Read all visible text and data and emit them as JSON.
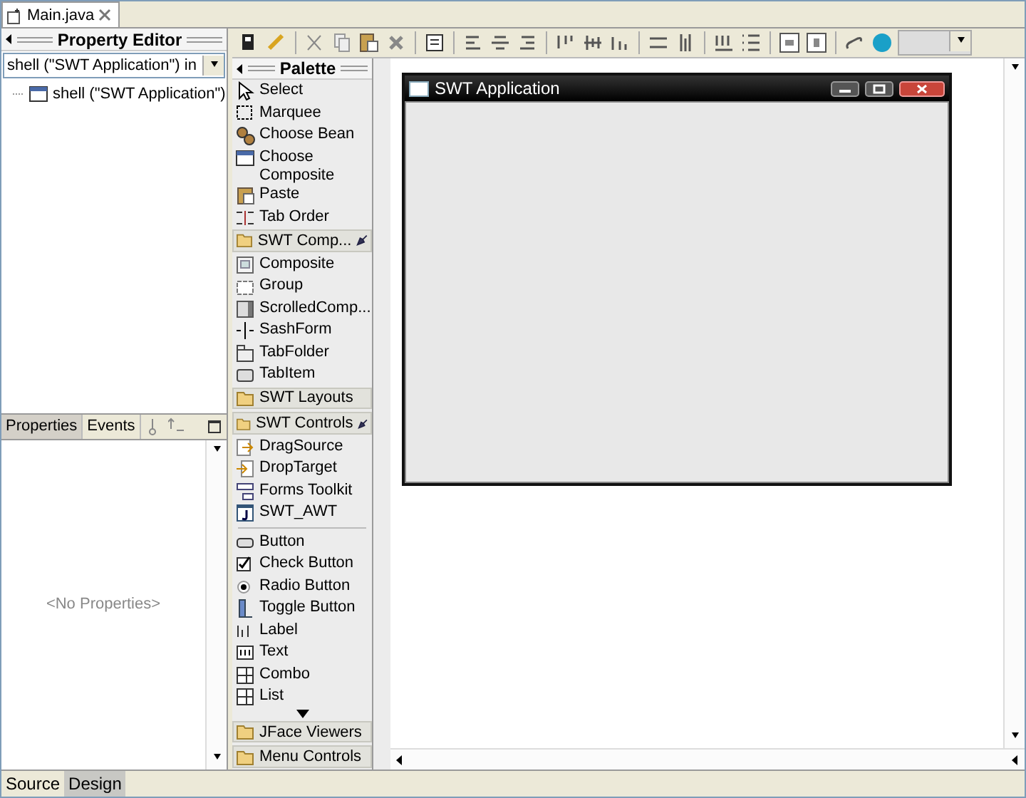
{
  "editor_tab": {
    "title": "Main.java"
  },
  "property_editor": {
    "title": "Property Editor",
    "selector": {
      "value": "shell (\"SWT Application\") in"
    },
    "tree": [
      {
        "label": "shell (\"SWT Application\")",
        "kind": "window"
      }
    ]
  },
  "properties_panel": {
    "tabs": [
      {
        "label": "Properties",
        "selected": true
      },
      {
        "label": "Events",
        "selected": false
      }
    ],
    "empty_message": "<No Properties>"
  },
  "palette": {
    "title": "Palette",
    "sections": [
      {
        "groups": [
          {
            "items": [
              {
                "label": "Select",
                "kind": "cursor"
              },
              {
                "label": "Marquee",
                "kind": "marquee"
              },
              {
                "label": "Choose Bean",
                "kind": "beans"
              },
              {
                "label": "Choose Composite",
                "kind": "window"
              },
              {
                "label": "Paste",
                "kind": "clipboard"
              },
              {
                "label": "Tab Order",
                "kind": "taborder"
              }
            ]
          }
        ]
      },
      {
        "header": "SWT Comp...",
        "pinned": true,
        "groups": [
          {
            "items": [
              {
                "label": "Composite",
                "kind": "panel"
              },
              {
                "label": "Group",
                "kind": "group"
              },
              {
                "label": "ScrolledComp...",
                "kind": "scrolled"
              },
              {
                "label": "SashForm",
                "kind": "sash"
              },
              {
                "label": "TabFolder",
                "kind": "folder"
              },
              {
                "label": "TabItem",
                "kind": "tab"
              }
            ]
          }
        ]
      },
      {
        "header": "SWT Layouts",
        "pinned": false
      },
      {
        "header": "SWT Controls",
        "pinned": true,
        "groups": [
          {
            "items": [
              {
                "label": "DragSource",
                "kind": "drag"
              },
              {
                "label": "DropTarget",
                "kind": "drop"
              },
              {
                "label": "Forms Toolkit",
                "kind": "forms"
              },
              {
                "label": "SWT_AWT",
                "kind": "jbox"
              }
            ]
          },
          {
            "items": [
              {
                "label": "Button",
                "kind": "button"
              },
              {
                "label": "Check Button",
                "kind": "check"
              },
              {
                "label": "Radio Button",
                "kind": "radio"
              },
              {
                "label": "Toggle Button",
                "kind": "toggle"
              },
              {
                "label": "Label",
                "kind": "label"
              },
              {
                "label": "Text",
                "kind": "text"
              },
              {
                "label": "Combo",
                "kind": "combo"
              },
              {
                "label": "List",
                "kind": "combo"
              }
            ]
          }
        ],
        "more_below": true
      },
      {
        "header": "JFace Viewers",
        "pinned": false
      },
      {
        "header": "Menu Controls",
        "pinned": false
      }
    ]
  },
  "design": {
    "shell": {
      "title": "SWT Application"
    }
  },
  "bottom_tabs": [
    {
      "label": "Source",
      "selected": false
    },
    {
      "label": "Design",
      "selected": true
    }
  ]
}
